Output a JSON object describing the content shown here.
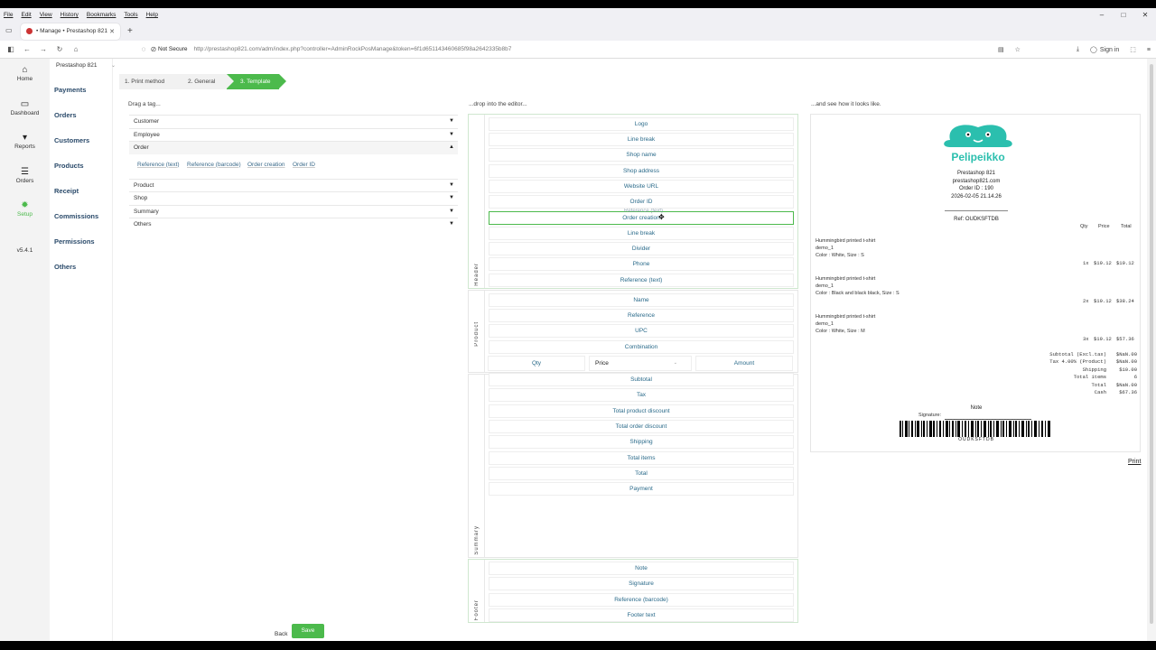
{
  "browser": {
    "menu": [
      "File",
      "Edit",
      "View",
      "History",
      "Bookmarks",
      "Tools",
      "Help"
    ],
    "tab_title": "• Manage • Prestashop 821",
    "not_secure": "Not Secure",
    "url": "http://prestashop821.com/adm/index.php?controller=AdminRockPosManage&token=6f1d651143460685f98a2642335b8b7",
    "sign_in": "Sign in"
  },
  "leftnav": {
    "items": [
      {
        "label": "Home",
        "icon": "home-icon"
      },
      {
        "label": "Dashboard",
        "icon": "laptop-icon"
      },
      {
        "label": "Reports",
        "icon": "cart-icon"
      },
      {
        "label": "Orders",
        "icon": "list-icon"
      },
      {
        "label": "Setup",
        "icon": "gear-icon",
        "active": true
      }
    ],
    "version": "v5.4.1"
  },
  "subnav": {
    "shop": "Prestashop 821",
    "items": [
      "Payments",
      "Orders",
      "Customers",
      "Products",
      "Receipt",
      "Commissions",
      "Permissions",
      "Others"
    ]
  },
  "steps": [
    "1. Print method",
    "2. General",
    "3. Template"
  ],
  "tags": {
    "title": "Drag a tag...",
    "groups": [
      "Customer",
      "Employee",
      "Order",
      "Product",
      "Shop",
      "Summary",
      "Others"
    ],
    "order_chips": [
      "Reference (text)",
      "Reference (barcode)",
      "Order creation",
      "Order ID"
    ]
  },
  "editor": {
    "title": "...drop into the editor...",
    "header_label": "Header",
    "header_rows": [
      "Logo",
      "Line break",
      "Shop name",
      "Shop address",
      "Website URL",
      "Order ID",
      "Order creation",
      "Line break",
      "Divider",
      "Phone",
      "Reference (text)"
    ],
    "drag_ghost": "Reference (text)",
    "product_label": "Product",
    "product_rows": [
      "Name",
      "Reference",
      "UPC",
      "Combination"
    ],
    "qty": "Qty",
    "price": "Price",
    "amount": "Amount",
    "summary_label": "Summary",
    "summary_rows": [
      "Subtotal",
      "Tax",
      "Total product discount",
      "Total order discount",
      "Shipping",
      "Total items",
      "Total",
      "Payment"
    ],
    "footer_label": "Footer",
    "footer_rows": [
      "Note",
      "Signature",
      "Reference (barcode)",
      "Footer text"
    ]
  },
  "preview": {
    "title": "...and see how it looks like.",
    "logo_text": "Pelipeikko",
    "shop_name": "Prestashop 821",
    "website": "prestashop821.com",
    "order_id": "Order ID : 190",
    "date": "2026-02-05 21.14.26",
    "ref": "Ref: OUDKSFTDB",
    "col_qty": "Qty",
    "col_price": "Price",
    "col_total": "Total",
    "lines": [
      {
        "name": "Hummingbird printed t-shirt",
        "ref": "demo_1",
        "attr": "Color : White, Size : S",
        "qty": "1x",
        "price": "$19.12",
        "total": "$19.12"
      },
      {
        "name": "Hummingbird printed t-shirt",
        "ref": "demo_1",
        "attr": "Color : Black and black black, Size : S",
        "qty": "2x",
        "price": "$19.12",
        "total": "$38.24"
      },
      {
        "name": "Hummingbird printed t-shirt",
        "ref": "demo_1",
        "attr": "Color : White, Size : M",
        "qty": "3x",
        "price": "$19.12",
        "total": "$57.36"
      }
    ],
    "summary": [
      {
        "label": "Subtotal (Excl.tax)",
        "value": "$NaN.00"
      },
      {
        "label": "Tax 4.00% (Product)",
        "value": "$NaN.00"
      },
      {
        "label": "Shipping",
        "value": "$10.00"
      },
      {
        "label": "Total items",
        "value": "6"
      },
      {
        "label": "Total",
        "value": "$NaN.00"
      },
      {
        "label": "Cash",
        "value": "$67.36"
      }
    ],
    "note": "Note",
    "signature": "Signature:",
    "barcode_text": "OUDKSFTDB",
    "print": "Print"
  },
  "footer": {
    "back": "Back",
    "save": "Save"
  },
  "colors": {
    "accent": "#4cba4c",
    "link": "#2a6a8a",
    "logo": "#2bbfae"
  }
}
